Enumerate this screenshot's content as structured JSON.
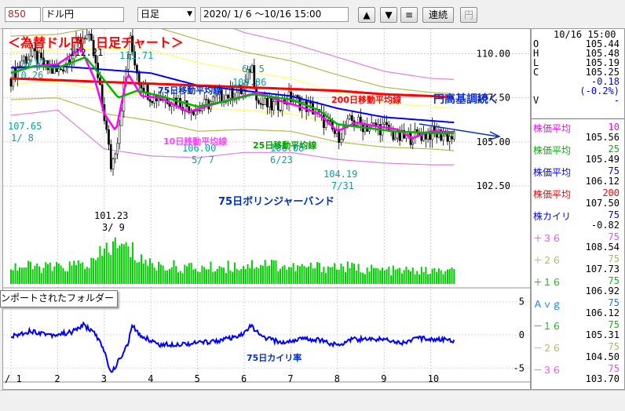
{
  "toolbar": {
    "code": "850",
    "name": "ドル円",
    "period": "日足",
    "range": "2020/ 1/ 6 〜10/16 15:00",
    "up_icon": "up-triangle-icon",
    "down_icon": "down-triangle-icon",
    "list_icon": "list-icon",
    "continuous_label": "連続",
    "yen_label": "円"
  },
  "colors": {
    "up": "#000000",
    "ma10": "#ff00ff",
    "ma25": "#00b400",
    "ma75": "#0000ff",
    "ma200": "#ff0000",
    "band1": "#ffff66",
    "band2": "#b8b84a",
    "band3": "#e080e0",
    "volume": "#00cc00",
    "annotation_red": "#ff0000"
  },
  "chart_data": [
    {
      "type": "line",
      "title": "＜為替ドル円　日足チャート＞",
      "x_labels": [
        "/ 1",
        "2",
        "3",
        "4",
        "5",
        "6",
        "7",
        "8",
        "9",
        "10"
      ],
      "ylim": [
        100.5,
        111.4
      ],
      "y_ticks": [
        "110.00",
        "107.50",
        "105.00",
        "102.50"
      ],
      "grid": true,
      "price_anchors": [
        {
          "month": 1.0,
          "close": 108.6
        },
        {
          "month": 1.25,
          "close": 109.7
        },
        {
          "month": 1.5,
          "close": 109.9
        },
        {
          "month": 1.75,
          "close": 109.2
        },
        {
          "month": 2.0,
          "close": 108.9
        },
        {
          "month": 2.3,
          "close": 110.0
        },
        {
          "month": 2.6,
          "close": 111.2
        },
        {
          "month": 2.75,
          "close": 110.2
        },
        {
          "month": 2.9,
          "close": 108.0
        },
        {
          "month": 3.0,
          "close": 106.5
        },
        {
          "month": 3.15,
          "close": 103.5
        },
        {
          "month": 3.3,
          "close": 105.5
        },
        {
          "month": 3.55,
          "close": 110.8
        },
        {
          "month": 3.75,
          "close": 108.5
        },
        {
          "month": 4.0,
          "close": 107.6
        },
        {
          "month": 4.5,
          "close": 107.4
        },
        {
          "month": 5.0,
          "close": 106.8
        },
        {
          "month": 5.5,
          "close": 107.6
        },
        {
          "month": 6.0,
          "close": 107.9
        },
        {
          "month": 6.15,
          "close": 109.5
        },
        {
          "month": 6.3,
          "close": 107.2
        },
        {
          "month": 6.6,
          "close": 107.0
        },
        {
          "month": 7.0,
          "close": 107.5
        },
        {
          "month": 7.5,
          "close": 106.8
        },
        {
          "month": 8.0,
          "close": 105.3
        },
        {
          "month": 8.3,
          "close": 106.2
        },
        {
          "month": 8.6,
          "close": 105.9
        },
        {
          "month": 9.0,
          "close": 105.8
        },
        {
          "month": 9.3,
          "close": 105.2
        },
        {
          "month": 9.6,
          "close": 105.3
        },
        {
          "month": 10.0,
          "close": 105.5
        },
        {
          "month": 10.5,
          "close": 105.25
        }
      ],
      "series": [
        {
          "name": "75日移動平均線",
          "values": [
            [
              1.0,
              109.2
            ],
            [
              2.0,
              109.3
            ],
            [
              3.0,
              109.1
            ],
            [
              4.0,
              108.9
            ],
            [
              5.0,
              108.2
            ],
            [
              6.0,
              107.9
            ],
            [
              7.0,
              107.6
            ],
            [
              8.0,
              106.9
            ],
            [
              9.0,
              106.4
            ],
            [
              10.0,
              106.2
            ],
            [
              10.5,
              106.1
            ]
          ]
        },
        {
          "name": "200日移動平均線",
          "values": [
            [
              1.0,
              108.6
            ],
            [
              2.0,
              108.5
            ],
            [
              3.0,
              108.4
            ],
            [
              4.0,
              108.3
            ],
            [
              5.0,
              108.2
            ],
            [
              6.0,
              108.1
            ],
            [
              7.0,
              108.0
            ],
            [
              8.0,
              107.9
            ],
            [
              9.0,
              107.7
            ],
            [
              10.0,
              107.6
            ],
            [
              10.5,
              107.5
            ]
          ]
        },
        {
          "name": "10日移動平均線",
          "values": [
            [
              1.0,
              108.9
            ],
            [
              1.5,
              109.3
            ],
            [
              2.0,
              109.4
            ],
            [
              2.5,
              110.3
            ],
            [
              2.8,
              108.5
            ],
            [
              3.0,
              106.6
            ],
            [
              3.25,
              105.6
            ],
            [
              3.5,
              108.9
            ],
            [
              3.8,
              107.6
            ],
            [
              4.2,
              107.5
            ],
            [
              4.8,
              106.7
            ],
            [
              5.3,
              107.1
            ],
            [
              6.0,
              107.6
            ],
            [
              6.3,
              107.8
            ],
            [
              6.8,
              107.3
            ],
            [
              7.2,
              107.0
            ],
            [
              7.6,
              106.6
            ],
            [
              8.0,
              105.6
            ],
            [
              8.4,
              106.1
            ],
            [
              8.8,
              105.9
            ],
            [
              9.3,
              105.7
            ],
            [
              9.6,
              105.2
            ],
            [
              10.0,
              105.6
            ],
            [
              10.5,
              105.56
            ]
          ]
        },
        {
          "name": "25日移動平均線",
          "values": [
            [
              1.0,
              108.9
            ],
            [
              1.5,
              109.3
            ],
            [
              2.0,
              109.2
            ],
            [
              2.6,
              109.8
            ],
            [
              3.0,
              108.5
            ],
            [
              3.3,
              107.5
            ],
            [
              3.7,
              107.9
            ],
            [
              4.2,
              107.6
            ],
            [
              5.0,
              107.0
            ],
            [
              5.6,
              107.3
            ],
            [
              6.2,
              107.7
            ],
            [
              7.0,
              107.4
            ],
            [
              7.6,
              106.8
            ],
            [
              8.0,
              106.0
            ],
            [
              8.6,
              105.8
            ],
            [
              9.2,
              105.6
            ],
            [
              10.0,
              105.5
            ],
            [
              10.5,
              105.49
            ]
          ]
        }
      ],
      "bands": {
        "plus3": [
          [
            1.0,
            111.9
          ],
          [
            2.0,
            111.8
          ],
          [
            3.0,
            113.0
          ],
          [
            4.0,
            113.1
          ],
          [
            5.0,
            112.2
          ],
          [
            6.0,
            111.2
          ],
          [
            7.0,
            110.6
          ],
          [
            8.0,
            109.8
          ],
          [
            9.0,
            109.0
          ],
          [
            10.0,
            108.6
          ],
          [
            10.5,
            108.54
          ]
        ],
        "plus2": [
          [
            1.0,
            111.0
          ],
          [
            2.0,
            111.1
          ],
          [
            3.0,
            111.6
          ],
          [
            4.0,
            111.6
          ],
          [
            5.0,
            110.8
          ],
          [
            6.0,
            110.1
          ],
          [
            7.0,
            109.6
          ],
          [
            8.0,
            108.8
          ],
          [
            9.0,
            108.1
          ],
          [
            10.0,
            107.8
          ],
          [
            10.5,
            107.73
          ]
        ],
        "plus1": [
          [
            1.0,
            110.1
          ],
          [
            2.0,
            110.2
          ],
          [
            3.0,
            110.3
          ],
          [
            4.0,
            110.2
          ],
          [
            5.0,
            109.5
          ],
          [
            6.0,
            109.0
          ],
          [
            7.0,
            108.6
          ],
          [
            8.0,
            107.8
          ],
          [
            9.0,
            107.2
          ],
          [
            10.0,
            107.0
          ],
          [
            10.5,
            106.92
          ]
        ],
        "minus1": [
          [
            1.0,
            108.3
          ],
          [
            2.0,
            108.4
          ],
          [
            3.0,
            107.9
          ],
          [
            4.0,
            107.6
          ],
          [
            5.0,
            106.9
          ],
          [
            6.0,
            106.8
          ],
          [
            7.0,
            106.6
          ],
          [
            8.0,
            106.0
          ],
          [
            9.0,
            105.6
          ],
          [
            10.0,
            105.4
          ],
          [
            10.5,
            105.31
          ]
        ],
        "minus2": [
          [
            1.0,
            107.4
          ],
          [
            2.0,
            107.5
          ],
          [
            3.0,
            106.6
          ],
          [
            4.0,
            106.2
          ],
          [
            5.0,
            105.6
          ],
          [
            6.0,
            105.7
          ],
          [
            7.0,
            105.6
          ],
          [
            8.0,
            105.0
          ],
          [
            9.0,
            104.7
          ],
          [
            10.0,
            104.6
          ],
          [
            10.5,
            104.5
          ]
        ],
        "minus3": [
          [
            1.0,
            106.5
          ],
          [
            2.0,
            106.8
          ],
          [
            3.0,
            104.6
          ],
          [
            4.0,
            104.2
          ],
          [
            5.0,
            104.1
          ],
          [
            6.0,
            104.4
          ],
          [
            7.0,
            104.4
          ],
          [
            8.0,
            104.0
          ],
          [
            9.0,
            103.8
          ],
          [
            10.0,
            103.7
          ],
          [
            10.5,
            103.7
          ]
        ]
      },
      "annotations": [
        {
          "text": "1/17",
          "color": "#0aa0a0"
        },
        {
          "text": "110.26",
          "color": "#0aa0a0"
        },
        {
          "text": "107.65",
          "color": "#0aa0a0"
        },
        {
          "text": "1/ 8",
          "color": "#0aa0a0"
        },
        {
          "text": "112.21",
          "color": "#000000"
        },
        {
          "text": "111.71",
          "color": "#0aa0a0"
        },
        {
          "text": "6/ 5",
          "color": "#0aa0a0"
        },
        {
          "text": "109.86",
          "color": "#0aa0a0"
        },
        {
          "text": "101.23",
          "color": "#000000"
        },
        {
          "text": "3/ 9",
          "color": "#000000"
        },
        {
          "text": "106.00",
          "color": "#0aa0a0"
        },
        {
          "text": "5/ 7",
          "color": "#0aa0a0"
        },
        {
          "text": "106.08",
          "color": "#0aa0a0"
        },
        {
          "text": "6/23",
          "color": "#0aa0a0"
        },
        {
          "text": "104.19",
          "color": "#0aa0a0"
        },
        {
          "text": "7/31",
          "color": "#0aa0a0"
        },
        {
          "text": "75日移動平均線",
          "color": "#0030c0"
        },
        {
          "text": "200日移動平均線",
          "color": "#ff0000"
        },
        {
          "text": "円高基調続く",
          "color": "#1030c0"
        },
        {
          "text": "10日移動平均線",
          "color": "#ff40ff"
        },
        {
          "text": "25日移動平均線",
          "color": "#00a000"
        },
        {
          "text": "75日ボリンジャーバンド",
          "color": "#0030c0"
        }
      ]
    },
    {
      "type": "bar",
      "title": "",
      "volume_anchors": [
        [
          1.0,
          0.45
        ],
        [
          2.0,
          0.42
        ],
        [
          2.8,
          0.55
        ],
        [
          3.1,
          1.0
        ],
        [
          3.5,
          0.9
        ],
        [
          4.0,
          0.5
        ],
        [
          5.0,
          0.4
        ],
        [
          6.0,
          0.48
        ],
        [
          6.5,
          0.55
        ],
        [
          7.0,
          0.42
        ],
        [
          8.0,
          0.45
        ],
        [
          9.0,
          0.35
        ],
        [
          10.0,
          0.33
        ],
        [
          10.5,
          0.32
        ]
      ]
    },
    {
      "type": "line",
      "title": "75日カイリ率",
      "ylim": [
        -6.5,
        6.5
      ],
      "y_ticks": [
        "5",
        "0",
        "-5"
      ],
      "kairi_anchors": [
        [
          1.0,
          -0.3
        ],
        [
          1.4,
          0.6
        ],
        [
          1.9,
          0.0
        ],
        [
          2.3,
          0.4
        ],
        [
          2.55,
          1.5
        ],
        [
          2.8,
          0.3
        ],
        [
          3.0,
          -2.5
        ],
        [
          3.15,
          -5.8
        ],
        [
          3.3,
          -4.0
        ],
        [
          3.5,
          -1.5
        ],
        [
          3.6,
          1.4
        ],
        [
          3.75,
          0.0
        ],
        [
          4.2,
          -1.5
        ],
        [
          4.8,
          -1.3
        ],
        [
          5.3,
          -1.0
        ],
        [
          5.9,
          -0.3
        ],
        [
          6.15,
          1.4
        ],
        [
          6.35,
          -0.2
        ],
        [
          6.8,
          -1.2
        ],
        [
          7.2,
          -0.6
        ],
        [
          7.6,
          -0.7
        ],
        [
          8.0,
          -1.6
        ],
        [
          8.3,
          -0.6
        ],
        [
          8.6,
          -0.7
        ],
        [
          9.0,
          -0.6
        ],
        [
          9.4,
          -1.2
        ],
        [
          9.7,
          -0.5
        ],
        [
          10.0,
          -0.6
        ],
        [
          10.5,
          -0.82
        ]
      ]
    }
  ],
  "side_panel": {
    "datetime": "10/16 15:00",
    "ohlc": [
      {
        "label": "O",
        "value": "105.44"
      },
      {
        "label": "H",
        "value": "105.48"
      },
      {
        "label": "L",
        "value": "105.19"
      },
      {
        "label": "C",
        "value": "105.25"
      },
      {
        "label": "",
        "value": "-0.18"
      },
      {
        "label": "",
        "value": "(-0.2%)"
      },
      {
        "label": "V",
        "value": "-"
      }
    ],
    "indicators": [
      {
        "label": "株価平均",
        "param": "10",
        "value": "105.56",
        "color": "#ff00ff"
      },
      {
        "label": "株価平均",
        "param": "25",
        "value": "105.49",
        "color": "#00b400"
      },
      {
        "label": "株価平均",
        "param": "75",
        "value": "106.12",
        "color": "#0000ff"
      },
      {
        "label": "株価平均",
        "param": "200",
        "value": "107.50",
        "color": "#ff0000"
      },
      {
        "label": "株カイリ",
        "param": "75",
        "value": "-0.82",
        "color": "#0000ff"
      },
      {
        "label": "＋３６",
        "param": "75",
        "value": "108.54",
        "color": "#ff40ff"
      },
      {
        "label": "＋２６",
        "param": "75",
        "value": "107.73",
        "color": "#b8b84a"
      },
      {
        "label": "＋１６",
        "param": "75",
        "value": "106.92",
        "color": "#00c000"
      },
      {
        "label": "Ａｖｇ",
        "param": "75",
        "value": "106.12",
        "color": "#0080ff"
      },
      {
        "label": "－１６",
        "param": "75",
        "value": "105.31",
        "color": "#00c000"
      },
      {
        "label": "－２６",
        "param": "75",
        "value": "104.50",
        "color": "#b8b84a"
      },
      {
        "label": "－３６",
        "param": "75",
        "value": "103.70",
        "color": "#ff40ff"
      }
    ]
  },
  "tooltip": {
    "text": "ンポートされたフォルダー"
  }
}
